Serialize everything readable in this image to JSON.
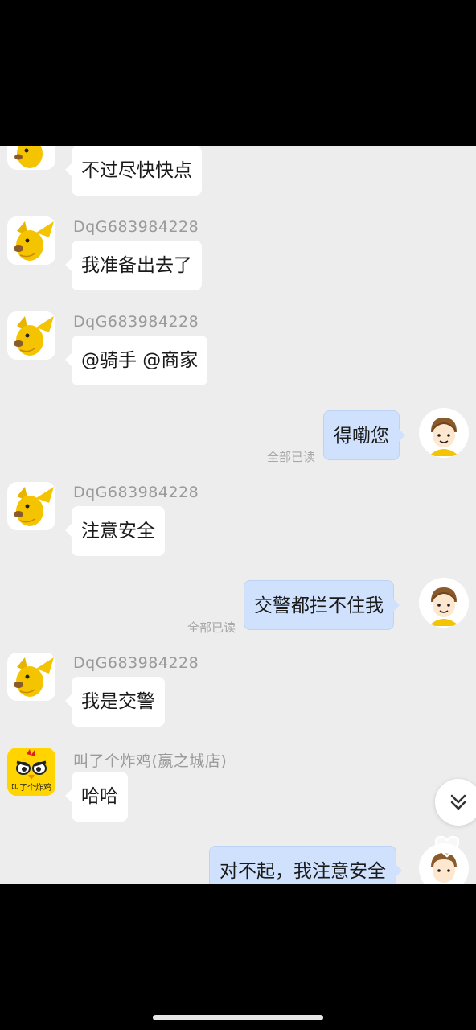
{
  "messages": [
    {
      "text": "不过尽快快点"
    },
    {
      "sender": "DqG683984228",
      "text": "我准备出去了"
    },
    {
      "sender": "DqG683984228",
      "text": "@骑手 @商家"
    },
    {
      "text": "得嘞您",
      "status": "全部已读"
    },
    {
      "sender": "DqG683984228",
      "text": "注意安全"
    },
    {
      "text": "交警都拦不住我",
      "status": "全部已读"
    },
    {
      "sender": "DqG683984228",
      "text": "我是交警"
    },
    {
      "sender": "叫了个炸鸡(赢之城店)",
      "text": "哈哈"
    },
    {
      "text": "对不起，我注意安全"
    }
  ],
  "shop_logo_text": "叫了个炸鸡",
  "icons": {
    "scroll": "chevron-double-down-icon",
    "like": "heart-icon"
  },
  "colors": {
    "chat_bg": "#ededed",
    "incoming_bubble": "#ffffff",
    "outgoing_bubble": "#cfe1fc",
    "avatar_yellow": "#f5c400"
  }
}
